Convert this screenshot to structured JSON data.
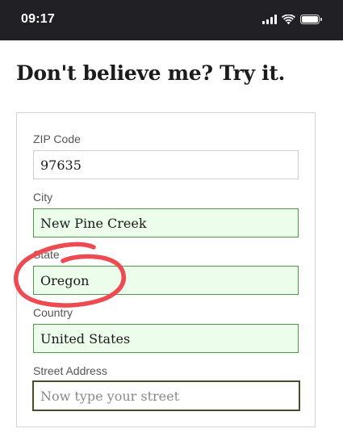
{
  "status_bar": {
    "time": "09:17",
    "icons": [
      "signal-icon",
      "wifi-icon",
      "battery-icon"
    ]
  },
  "heading": "Don't believe me? Try it.",
  "form": {
    "zip": {
      "label": "ZIP Code",
      "value": "97635"
    },
    "city": {
      "label": "City",
      "value": "New Pine Creek"
    },
    "state": {
      "label": "State",
      "value": "Oregon"
    },
    "country": {
      "label": "Country",
      "value": "United States"
    },
    "street": {
      "label": "Street Address",
      "value": "",
      "placeholder": "Now type your street"
    }
  },
  "colors": {
    "valid_background": "#edfdeb",
    "valid_border": "#4f9a45",
    "annotation": "#ee4a52",
    "status_bar": "#212125"
  }
}
